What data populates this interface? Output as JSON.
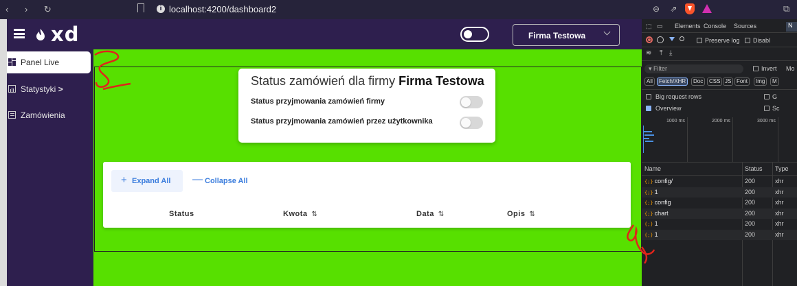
{
  "browser": {
    "url": "localhost:4200/dashboard2"
  },
  "app": {
    "logo_text": "xd",
    "company_select": "Firma Testowa",
    "sidebar": [
      {
        "label": "Panel Live",
        "active": true
      },
      {
        "label": "Statystyki",
        "has_submenu": true,
        "chevron": ">"
      },
      {
        "label": "Zamówienia"
      }
    ],
    "status_card": {
      "title_prefix": "Status zamówień dla firmy",
      "title_company": "Firma Testowa",
      "rows": [
        {
          "label": "Status przyjmowania zamówień firmy",
          "enabled": false
        },
        {
          "label": "Status przyjmowania zamówień przez użytkownika",
          "enabled": false
        }
      ]
    },
    "table": {
      "expand_all": "Expand All",
      "collapse_all": "Collapse All",
      "columns": [
        "Status",
        "Kwota",
        "Data",
        "Opis"
      ],
      "sort_glyph": "⇅"
    },
    "accent_color": "#57e000",
    "nav_color": "#2e1f4e"
  },
  "devtools": {
    "tabs": [
      "Elements",
      "Console",
      "Sources",
      "N"
    ],
    "preserve_log": "Preserve log",
    "disable_cache": "Disabl",
    "filter_placeholder": "Filter",
    "invert": "Invert",
    "more": "Mo",
    "chips": [
      "All",
      "Fetch/XHR",
      "Doc",
      "CSS",
      "JS",
      "Font",
      "Img",
      "M"
    ],
    "big_request_rows": "Big request rows",
    "overview": "Overview",
    "g_partial": "G",
    "s_partial": "Sc",
    "timeline_ticks": [
      "1000 ms",
      "2000 ms",
      "3000 ms"
    ],
    "columns": [
      "Name",
      "Status",
      "Type"
    ],
    "rows": [
      {
        "name": "config/",
        "status": "200",
        "type": "xhr"
      },
      {
        "name": "1",
        "status": "200",
        "type": "xhr"
      },
      {
        "name": "config",
        "status": "200",
        "type": "xhr"
      },
      {
        "name": "chart",
        "status": "200",
        "type": "xhr"
      },
      {
        "name": "1",
        "status": "200",
        "type": "xhr"
      },
      {
        "name": "1",
        "status": "200",
        "type": "xhr"
      }
    ]
  }
}
